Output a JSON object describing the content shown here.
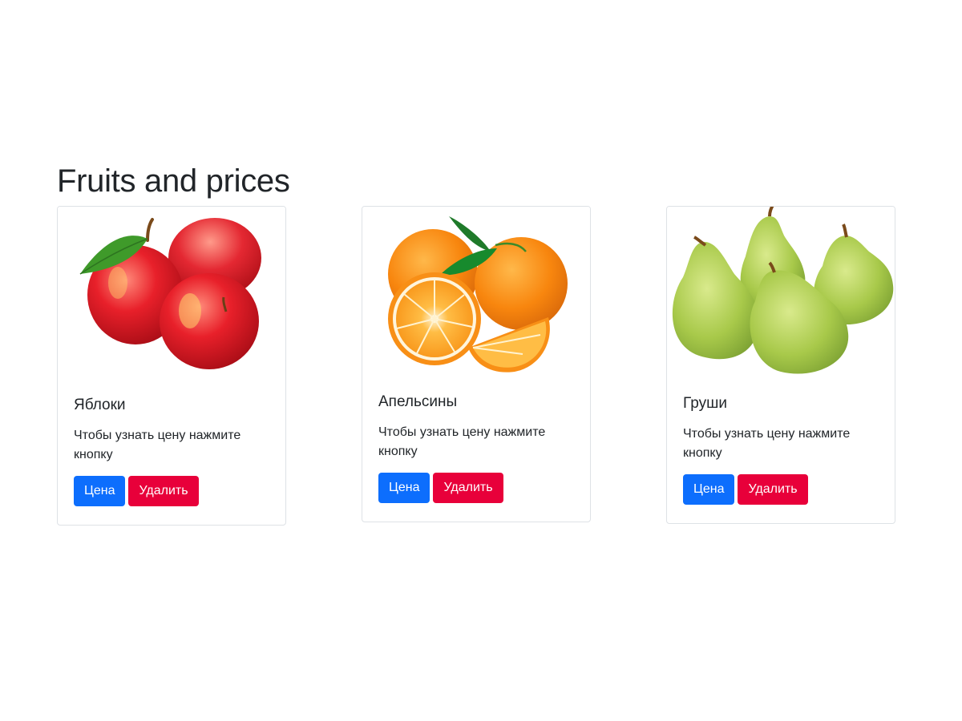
{
  "page": {
    "title": "Fruits and prices"
  },
  "cards": [
    {
      "title": "Яблоки",
      "text": "Чтобы узнать цену нажмите кнопку",
      "price_button": "Цена",
      "delete_button": "Удалить",
      "image": "apples-image"
    },
    {
      "title": "Апельсины",
      "text": "Чтобы узнать цену нажмите кнопку",
      "price_button": "Цена",
      "delete_button": "Удалить",
      "image": "oranges-image"
    },
    {
      "title": "Груши",
      "text": "Чтобы узнать цену нажмите кнопку",
      "price_button": "Цена",
      "delete_button": "Удалить",
      "image": "pears-image"
    }
  ],
  "colors": {
    "primary": "#0d6efd",
    "danger": "#e8003a",
    "border": "#dee2e6",
    "text": "#212529"
  }
}
